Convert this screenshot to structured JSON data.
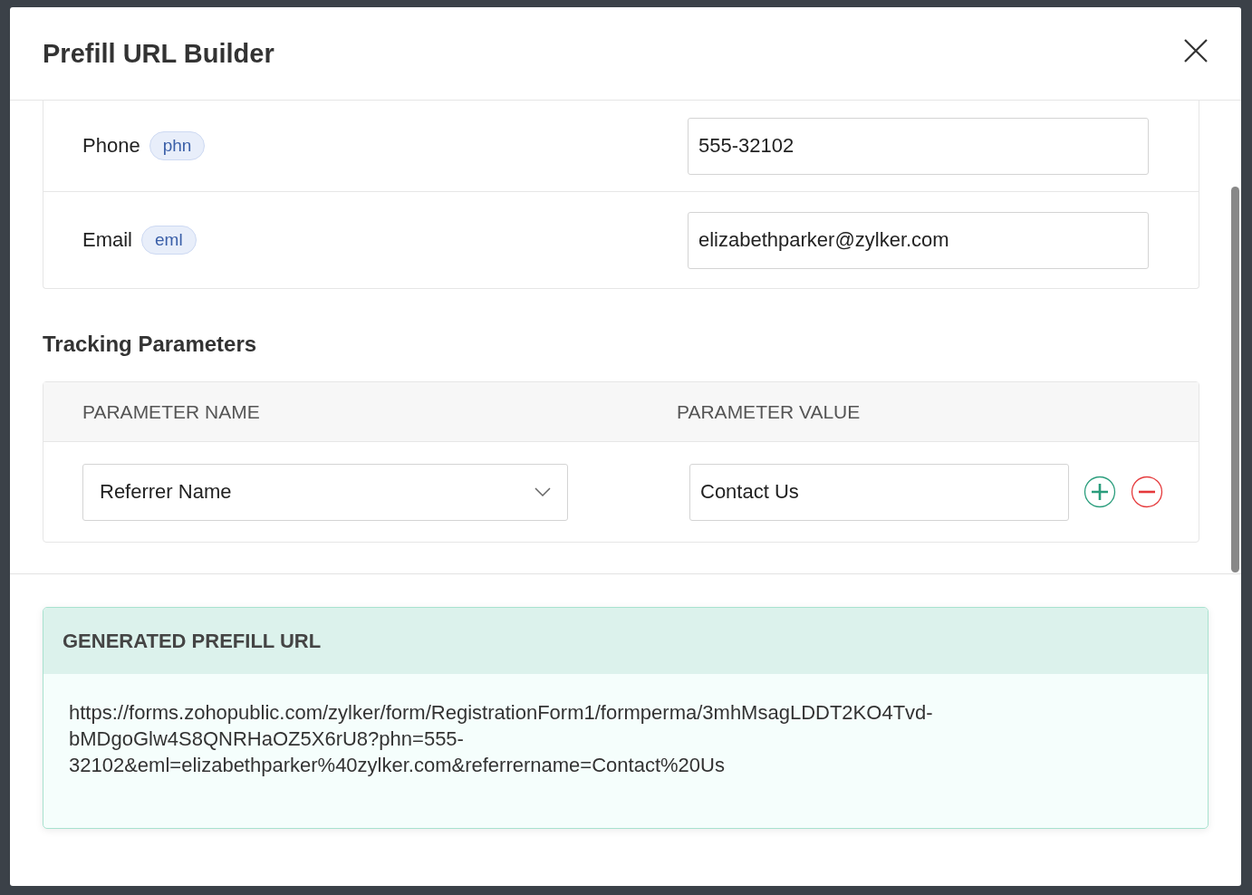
{
  "dialog": {
    "title": "Prefill URL Builder"
  },
  "fields": [
    {
      "label": "Phone",
      "alias": "phn",
      "value": "555-32102"
    },
    {
      "label": "Email",
      "alias": "eml",
      "value": "elizabethparker@zylker.com"
    }
  ],
  "tracking": {
    "heading": "Tracking Parameters",
    "columns": [
      "PARAMETER NAME",
      "PARAMETER VALUE"
    ],
    "rows": [
      {
        "name": "Referrer Name",
        "value": "Contact Us"
      }
    ]
  },
  "generated": {
    "heading": "GENERATED PREFILL URL",
    "url": "https://forms.zohopublic.com/zylker/form/RegistrationForm1/formperma/3mhMsagLDDT2KO4Tvd-bMDgoGlw4S8QNRHaOZ5X6rU8?phn=555-32102&eml=elizabethparker%40zylker.com&referrername=Contact%20Us"
  }
}
